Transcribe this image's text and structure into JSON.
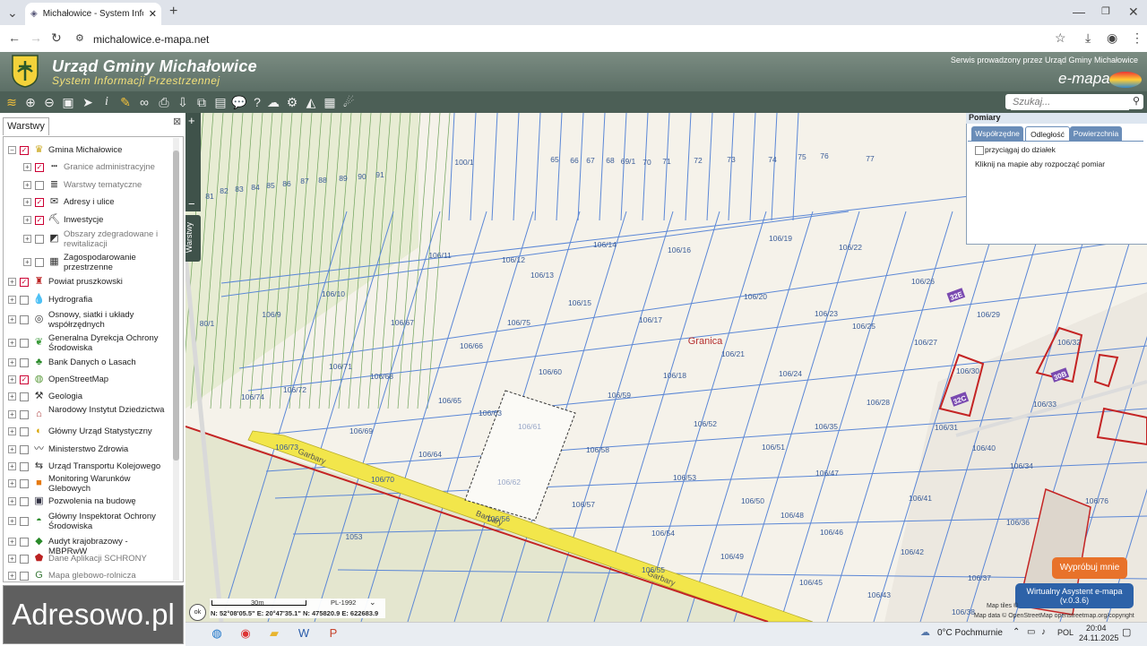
{
  "browser": {
    "tab_title": "Michałowice - System Informacj",
    "url": "michalowice.e-mapa.net"
  },
  "header": {
    "title": "Urząd Gminy Michałowice",
    "subtitle": "System Informacji Przestrzennej",
    "service_note": "Serwis prowadzony przez Urząd Gminy Michałowice",
    "brand": "e-mapa"
  },
  "search": {
    "placeholder": "Szukaj..."
  },
  "panel": {
    "tab": "Warstwy",
    "layers": [
      {
        "label": "Gmina Michałowice",
        "checked": true,
        "level": 0,
        "icon": "coat-of-arms-icon"
      },
      {
        "label": "Granice administracyjne",
        "checked": true,
        "level": 1,
        "grey": true,
        "icon": "boundary-line-icon"
      },
      {
        "label": "Warstwy tematyczne",
        "checked": false,
        "level": 1,
        "grey": true,
        "icon": "layers-stack-icon"
      },
      {
        "label": "Adresy i ulice",
        "checked": true,
        "level": 1,
        "icon": "envelope-icon"
      },
      {
        "label": "Inwestycje",
        "checked": true,
        "level": 1,
        "icon": "excavator-icon"
      },
      {
        "label": "Obszary zdegradowane i rewitalizacji",
        "checked": false,
        "level": 1,
        "grey": true,
        "icon": "area-icon"
      },
      {
        "label": "Zagospodarowanie przestrzenne",
        "checked": false,
        "level": 1,
        "icon": "planning-icon"
      },
      {
        "label": "Powiat pruszkowski",
        "checked": true,
        "level": 0,
        "icon": "county-crest-icon"
      },
      {
        "label": "Hydrografia",
        "checked": false,
        "level": 0,
        "icon": "water-drop-icon"
      },
      {
        "label": "Osnowy, siatki i układy współrzędnych",
        "checked": false,
        "level": 0,
        "icon": "globe-grid-icon"
      },
      {
        "label": "Generalna Dyrekcja Ochrony Środowiska",
        "checked": false,
        "level": 0,
        "icon": "leaf-icon"
      },
      {
        "label": "Bank Danych o Lasach",
        "checked": false,
        "level": 0,
        "icon": "tree-icon"
      },
      {
        "label": "OpenStreetMap",
        "checked": true,
        "level": 0,
        "icon": "osm-icon"
      },
      {
        "label": "Geologia",
        "checked": false,
        "level": 0,
        "icon": "hammer-icon"
      },
      {
        "label": "Narodowy Instytut Dziedzictwa",
        "checked": false,
        "level": 0,
        "icon": "heritage-icon"
      },
      {
        "label": "Główny Urząd Statystyczny",
        "checked": false,
        "level": 0,
        "icon": "statistics-icon"
      },
      {
        "label": "Ministerstwo Zdrowia",
        "checked": false,
        "level": 0,
        "icon": "health-icon"
      },
      {
        "label": "Urząd Transportu Kolejowego",
        "checked": false,
        "level": 0,
        "icon": "rail-icon"
      },
      {
        "label": "Monitoring Warunków Glebowych",
        "checked": false,
        "level": 0,
        "icon": "soil-icon"
      },
      {
        "label": "Pozwolenia na budowę",
        "checked": false,
        "level": 0,
        "icon": "permit-icon"
      },
      {
        "label": "Główny Inspektorat Ochrony Środowiska",
        "checked": false,
        "level": 0,
        "icon": "gios-icon"
      },
      {
        "label": "Audyt krajobrazowy - MBPRwW",
        "checked": false,
        "level": 0,
        "icon": "landscape-icon"
      },
      {
        "label": "Dane Aplikacji SCHRONY",
        "checked": false,
        "level": 0,
        "grey": true,
        "icon": "shelter-icon"
      },
      {
        "label": "Mapa glebowo-rolnicza",
        "checked": false,
        "level": 0,
        "grey": true,
        "icon": "soil-map-icon"
      }
    ],
    "side_tab": "Warstwy"
  },
  "watermark": "Adresowo.pl",
  "measure": {
    "title": "Pomiary",
    "tabs": [
      "Współrzędne",
      "Odległość",
      "Powierzchnia"
    ],
    "active_tab": "Odległość",
    "snap_label": "przyciągaj do działek",
    "hint": "Kliknij na mapie aby rozpocząć pomiar"
  },
  "map": {
    "place_label": "Granica",
    "street_labels": [
      "Garbary",
      "Barbary",
      "Garbary"
    ],
    "parcels": [
      "100/1",
      "65",
      "66",
      "67",
      "68",
      "69/1",
      "70",
      "71",
      "72",
      "73",
      "74",
      "75",
      "76",
      "77",
      "81",
      "82",
      "83",
      "84",
      "85",
      "86",
      "87",
      "88",
      "89",
      "90",
      "91",
      "106/11",
      "106/12",
      "106/13",
      "106/14",
      "106/16",
      "106/19",
      "106/22",
      "106/26",
      "106/29",
      "106/10",
      "106/9",
      "106/15",
      "106/17",
      "106/20",
      "106/23",
      "106/25",
      "106/27",
      "106/67",
      "106/66",
      "106/75",
      "106/71",
      "106/68",
      "106/60",
      "106/59",
      "106/18",
      "106/21",
      "106/24",
      "106/28",
      "106/30",
      "106/32",
      "106/33",
      "106/72",
      "106/74",
      "106/65",
      "106/63",
      "106/61",
      "106/69",
      "106/64",
      "106/58",
      "106/52",
      "106/51",
      "106/35",
      "106/31",
      "106/40",
      "106/34",
      "106/73",
      "106/70",
      "106/62",
      "106/57",
      "106/53",
      "106/47",
      "106/41",
      "106/56",
      "106/54",
      "106/50",
      "106/48",
      "106/46",
      "106/36",
      "106/76",
      "106/55",
      "106/49",
      "106/42",
      "106/45",
      "106/37",
      "106/43",
      "106/38",
      "80/1",
      "1053"
    ],
    "building_tags": [
      "32E",
      "30B",
      "32C"
    ],
    "attribution_1": "Map tiles ©",
    "attribution_2": "Map data © OpenStreetMap openstreetmap.org/copyright"
  },
  "scalebar": {
    "scale": "30m",
    "crs": "PL-1992",
    "coords": "N: 52°08'05.5\" E: 20°47'35.1\"  N: 475820.9  E: 622683.9",
    "ok": "ok"
  },
  "floating": {
    "try_button": "Wypróbuj mnie",
    "assistant": "Wirtualny Asystent e-mapa",
    "assistant_version": "(v.0.3.6)"
  },
  "taskbar": {
    "weather": "0°C  Pochmurnie",
    "lang": "POL",
    "time": "20:04",
    "date": "24.11.2025"
  },
  "colors": {
    "header": "#5c6f66",
    "parcel_line": "#5b87d6",
    "road": "#f2e64b",
    "boundary": "#c42424",
    "measure_tab": "#6a8db8"
  }
}
